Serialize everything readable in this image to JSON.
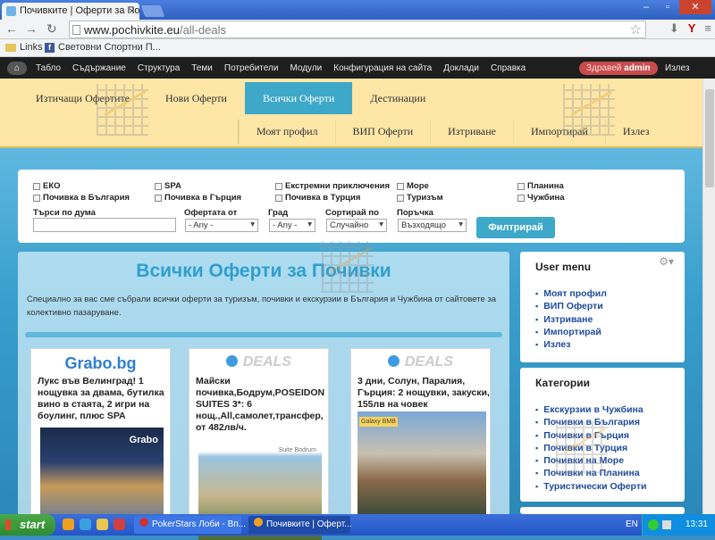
{
  "browser": {
    "tab_title": "Почивките | Оферти за Поч",
    "url_host": "www.pochivkite.eu",
    "url_path": "/all-deals",
    "bookmarks": [
      "Links",
      "Световни Спортни П..."
    ]
  },
  "admin_bar": {
    "items": [
      "Табло",
      "Съдържание",
      "Структура",
      "Теми",
      "Потребители",
      "Модули",
      "Конфигурация на сайта",
      "Доклади",
      "Справка"
    ],
    "hello_prefix": "Здравей",
    "hello_user": "admin",
    "logout": "Излез"
  },
  "site_nav": {
    "primary": [
      "Изтичащи Офертите",
      "Нови Оферти",
      "Всички Оферти",
      "Дестинации"
    ],
    "primary_active": "Всички Оферти",
    "secondary": [
      "Моят профил",
      "ВИП Оферти",
      "Изтриване",
      "Импортирай",
      "Излез"
    ]
  },
  "filter": {
    "checkboxes": [
      "ЕКО",
      "SPA",
      "Екстремни приключения",
      "Море",
      "Планина",
      "Почивка в България",
      "Почивка в Гърция",
      "Почивка в Турция",
      "Туризъм",
      "Чужбина"
    ],
    "search_label": "Търси по дума",
    "offer_from_label": "Офертата от",
    "offer_from_value": "- Any -",
    "city_label": "Град",
    "city_value": "- Any -",
    "sort_label": "Сортирай по",
    "sort_value": "Случайно",
    "order_label": "Поръчка",
    "order_value": "Възходящо",
    "button": "Филтрирай"
  },
  "main": {
    "title": "Всички Оферти за Почивки",
    "description": "Специално за вас сме събрали всички оферти за туризъм, почивки и екскурзии в България и Чужбина от сайтовете за колективно пазаруване.",
    "cards": [
      {
        "source": "Grabo.bg",
        "title": "Лукс във Велинград! 1 нощувка за двама, бутилка вино в стаята, 2 игри на боулинг, плюс SPA",
        "image_label": "Grabo"
      },
      {
        "source": "DEALS",
        "title": "Майски почивка,Бодрум,POSEIDON SUITES 3*: 6 нощ.,All,самолет,трансфер, от 482лв/ч.",
        "image_label": "Suite Bodrum"
      },
      {
        "source": "DEALS",
        "title": "3 дни, Солун, Паралия, Гърция: 2 нощувки, закуски, 155лв на човек",
        "image_label": "Galaxy BMB"
      }
    ]
  },
  "sidebar": {
    "user_menu_title": "User menu",
    "user_menu": [
      "Моят профил",
      "ВИП Оферти",
      "Изтриване",
      "Импортирай",
      "Излез"
    ],
    "categories_title": "Категории",
    "categories": [
      "Екскурзии в Чужбина",
      "Почивки в България",
      "Почивки в Гърция",
      "Почивки в Турция",
      "Почивки на Море",
      "Почивки на Планина",
      "Туристически Оферти"
    ]
  },
  "taskbar": {
    "start": "start",
    "tasks": [
      "PokerStars Лоби - Вп...",
      "Почивките | Оферт..."
    ],
    "lang": "EN",
    "time": "13:31"
  }
}
